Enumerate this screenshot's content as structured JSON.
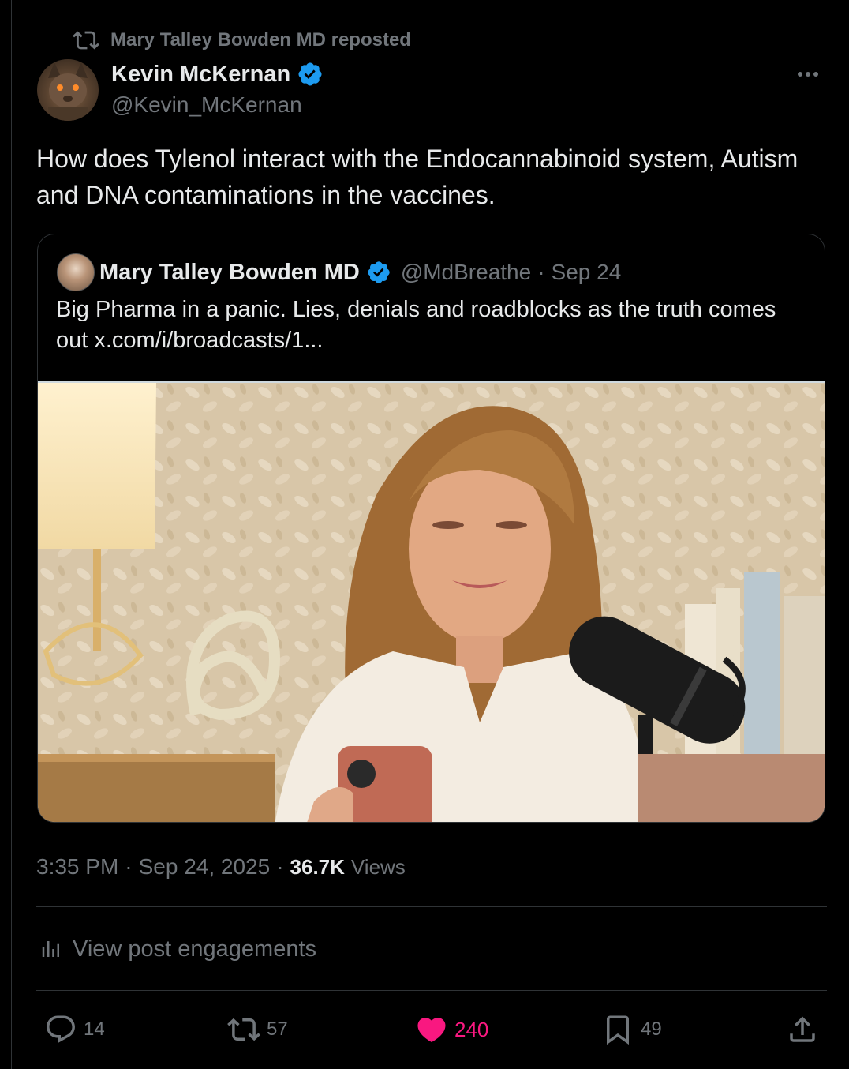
{
  "repost": {
    "text": "Mary Talley Bowden MD reposted",
    "icon": "repost-icon"
  },
  "author": {
    "name": "Kevin McKernan",
    "handle": "@Kevin_McKernan",
    "verified": true
  },
  "post": {
    "text": "How does Tylenol interact with the Endocannabinoid system, Autism and DNA contaminations in the vaccines."
  },
  "quote": {
    "name": "Mary Talley Bowden MD",
    "handle": "@MdBreathe",
    "separator": "·",
    "date": "Sep 24",
    "text": "Big Pharma in a panic. Lies, denials and roadblocks as the truth comes out x.com/i/broadcasts/1..."
  },
  "meta": {
    "time": "3:35 PM",
    "separator": "·",
    "date": "Sep 24, 2025",
    "views_count": "36.7K",
    "views_label": "Views"
  },
  "engagements_label": "View post engagements",
  "actions": {
    "replies": "14",
    "reposts": "57",
    "likes": "240",
    "bookmarks": "49"
  },
  "colors": {
    "background": "#000000",
    "text": "#e7e9ea",
    "secondary": "#71767b",
    "verified": "#1d9bf0",
    "like": "#f91880",
    "border": "#2f3336"
  }
}
